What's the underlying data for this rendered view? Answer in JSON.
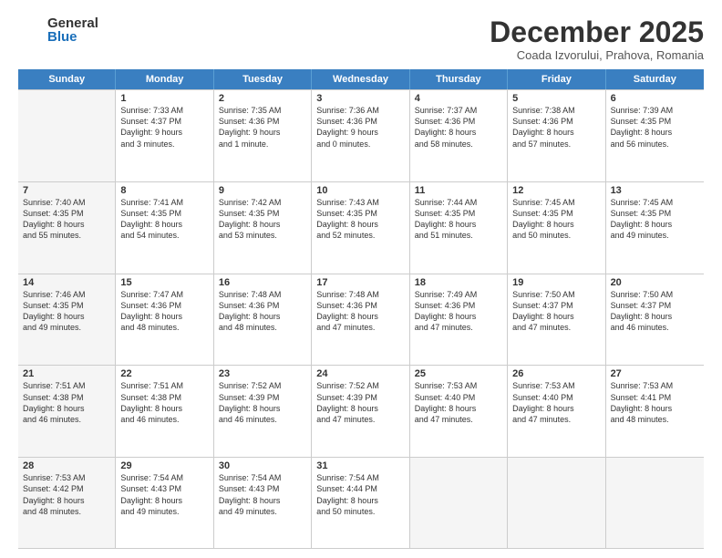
{
  "logo": {
    "general": "General",
    "blue": "Blue"
  },
  "header": {
    "month": "December 2025",
    "location": "Coada Izvorului, Prahova, Romania"
  },
  "weekdays": [
    "Sunday",
    "Monday",
    "Tuesday",
    "Wednesday",
    "Thursday",
    "Friday",
    "Saturday"
  ],
  "rows": [
    [
      {
        "day": "",
        "lines": [],
        "shaded": true
      },
      {
        "day": "1",
        "lines": [
          "Sunrise: 7:33 AM",
          "Sunset: 4:37 PM",
          "Daylight: 9 hours",
          "and 3 minutes."
        ],
        "shaded": false
      },
      {
        "day": "2",
        "lines": [
          "Sunrise: 7:35 AM",
          "Sunset: 4:36 PM",
          "Daylight: 9 hours",
          "and 1 minute."
        ],
        "shaded": false
      },
      {
        "day": "3",
        "lines": [
          "Sunrise: 7:36 AM",
          "Sunset: 4:36 PM",
          "Daylight: 9 hours",
          "and 0 minutes."
        ],
        "shaded": false
      },
      {
        "day": "4",
        "lines": [
          "Sunrise: 7:37 AM",
          "Sunset: 4:36 PM",
          "Daylight: 8 hours",
          "and 58 minutes."
        ],
        "shaded": false
      },
      {
        "day": "5",
        "lines": [
          "Sunrise: 7:38 AM",
          "Sunset: 4:36 PM",
          "Daylight: 8 hours",
          "and 57 minutes."
        ],
        "shaded": false
      },
      {
        "day": "6",
        "lines": [
          "Sunrise: 7:39 AM",
          "Sunset: 4:35 PM",
          "Daylight: 8 hours",
          "and 56 minutes."
        ],
        "shaded": false
      }
    ],
    [
      {
        "day": "7",
        "lines": [
          "Sunrise: 7:40 AM",
          "Sunset: 4:35 PM",
          "Daylight: 8 hours",
          "and 55 minutes."
        ],
        "shaded": true
      },
      {
        "day": "8",
        "lines": [
          "Sunrise: 7:41 AM",
          "Sunset: 4:35 PM",
          "Daylight: 8 hours",
          "and 54 minutes."
        ],
        "shaded": false
      },
      {
        "day": "9",
        "lines": [
          "Sunrise: 7:42 AM",
          "Sunset: 4:35 PM",
          "Daylight: 8 hours",
          "and 53 minutes."
        ],
        "shaded": false
      },
      {
        "day": "10",
        "lines": [
          "Sunrise: 7:43 AM",
          "Sunset: 4:35 PM",
          "Daylight: 8 hours",
          "and 52 minutes."
        ],
        "shaded": false
      },
      {
        "day": "11",
        "lines": [
          "Sunrise: 7:44 AM",
          "Sunset: 4:35 PM",
          "Daylight: 8 hours",
          "and 51 minutes."
        ],
        "shaded": false
      },
      {
        "day": "12",
        "lines": [
          "Sunrise: 7:45 AM",
          "Sunset: 4:35 PM",
          "Daylight: 8 hours",
          "and 50 minutes."
        ],
        "shaded": false
      },
      {
        "day": "13",
        "lines": [
          "Sunrise: 7:45 AM",
          "Sunset: 4:35 PM",
          "Daylight: 8 hours",
          "and 49 minutes."
        ],
        "shaded": false
      }
    ],
    [
      {
        "day": "14",
        "lines": [
          "Sunrise: 7:46 AM",
          "Sunset: 4:35 PM",
          "Daylight: 8 hours",
          "and 49 minutes."
        ],
        "shaded": true
      },
      {
        "day": "15",
        "lines": [
          "Sunrise: 7:47 AM",
          "Sunset: 4:36 PM",
          "Daylight: 8 hours",
          "and 48 minutes."
        ],
        "shaded": false
      },
      {
        "day": "16",
        "lines": [
          "Sunrise: 7:48 AM",
          "Sunset: 4:36 PM",
          "Daylight: 8 hours",
          "and 48 minutes."
        ],
        "shaded": false
      },
      {
        "day": "17",
        "lines": [
          "Sunrise: 7:48 AM",
          "Sunset: 4:36 PM",
          "Daylight: 8 hours",
          "and 47 minutes."
        ],
        "shaded": false
      },
      {
        "day": "18",
        "lines": [
          "Sunrise: 7:49 AM",
          "Sunset: 4:36 PM",
          "Daylight: 8 hours",
          "and 47 minutes."
        ],
        "shaded": false
      },
      {
        "day": "19",
        "lines": [
          "Sunrise: 7:50 AM",
          "Sunset: 4:37 PM",
          "Daylight: 8 hours",
          "and 47 minutes."
        ],
        "shaded": false
      },
      {
        "day": "20",
        "lines": [
          "Sunrise: 7:50 AM",
          "Sunset: 4:37 PM",
          "Daylight: 8 hours",
          "and 46 minutes."
        ],
        "shaded": false
      }
    ],
    [
      {
        "day": "21",
        "lines": [
          "Sunrise: 7:51 AM",
          "Sunset: 4:38 PM",
          "Daylight: 8 hours",
          "and 46 minutes."
        ],
        "shaded": true
      },
      {
        "day": "22",
        "lines": [
          "Sunrise: 7:51 AM",
          "Sunset: 4:38 PM",
          "Daylight: 8 hours",
          "and 46 minutes."
        ],
        "shaded": false
      },
      {
        "day": "23",
        "lines": [
          "Sunrise: 7:52 AM",
          "Sunset: 4:39 PM",
          "Daylight: 8 hours",
          "and 46 minutes."
        ],
        "shaded": false
      },
      {
        "day": "24",
        "lines": [
          "Sunrise: 7:52 AM",
          "Sunset: 4:39 PM",
          "Daylight: 8 hours",
          "and 47 minutes."
        ],
        "shaded": false
      },
      {
        "day": "25",
        "lines": [
          "Sunrise: 7:53 AM",
          "Sunset: 4:40 PM",
          "Daylight: 8 hours",
          "and 47 minutes."
        ],
        "shaded": false
      },
      {
        "day": "26",
        "lines": [
          "Sunrise: 7:53 AM",
          "Sunset: 4:40 PM",
          "Daylight: 8 hours",
          "and 47 minutes."
        ],
        "shaded": false
      },
      {
        "day": "27",
        "lines": [
          "Sunrise: 7:53 AM",
          "Sunset: 4:41 PM",
          "Daylight: 8 hours",
          "and 48 minutes."
        ],
        "shaded": false
      }
    ],
    [
      {
        "day": "28",
        "lines": [
          "Sunrise: 7:53 AM",
          "Sunset: 4:42 PM",
          "Daylight: 8 hours",
          "and 48 minutes."
        ],
        "shaded": true
      },
      {
        "day": "29",
        "lines": [
          "Sunrise: 7:54 AM",
          "Sunset: 4:43 PM",
          "Daylight: 8 hours",
          "and 49 minutes."
        ],
        "shaded": false
      },
      {
        "day": "30",
        "lines": [
          "Sunrise: 7:54 AM",
          "Sunset: 4:43 PM",
          "Daylight: 8 hours",
          "and 49 minutes."
        ],
        "shaded": false
      },
      {
        "day": "31",
        "lines": [
          "Sunrise: 7:54 AM",
          "Sunset: 4:44 PM",
          "Daylight: 8 hours",
          "and 50 minutes."
        ],
        "shaded": false
      },
      {
        "day": "",
        "lines": [],
        "shaded": true
      },
      {
        "day": "",
        "lines": [],
        "shaded": true
      },
      {
        "day": "",
        "lines": [],
        "shaded": true
      }
    ]
  ]
}
